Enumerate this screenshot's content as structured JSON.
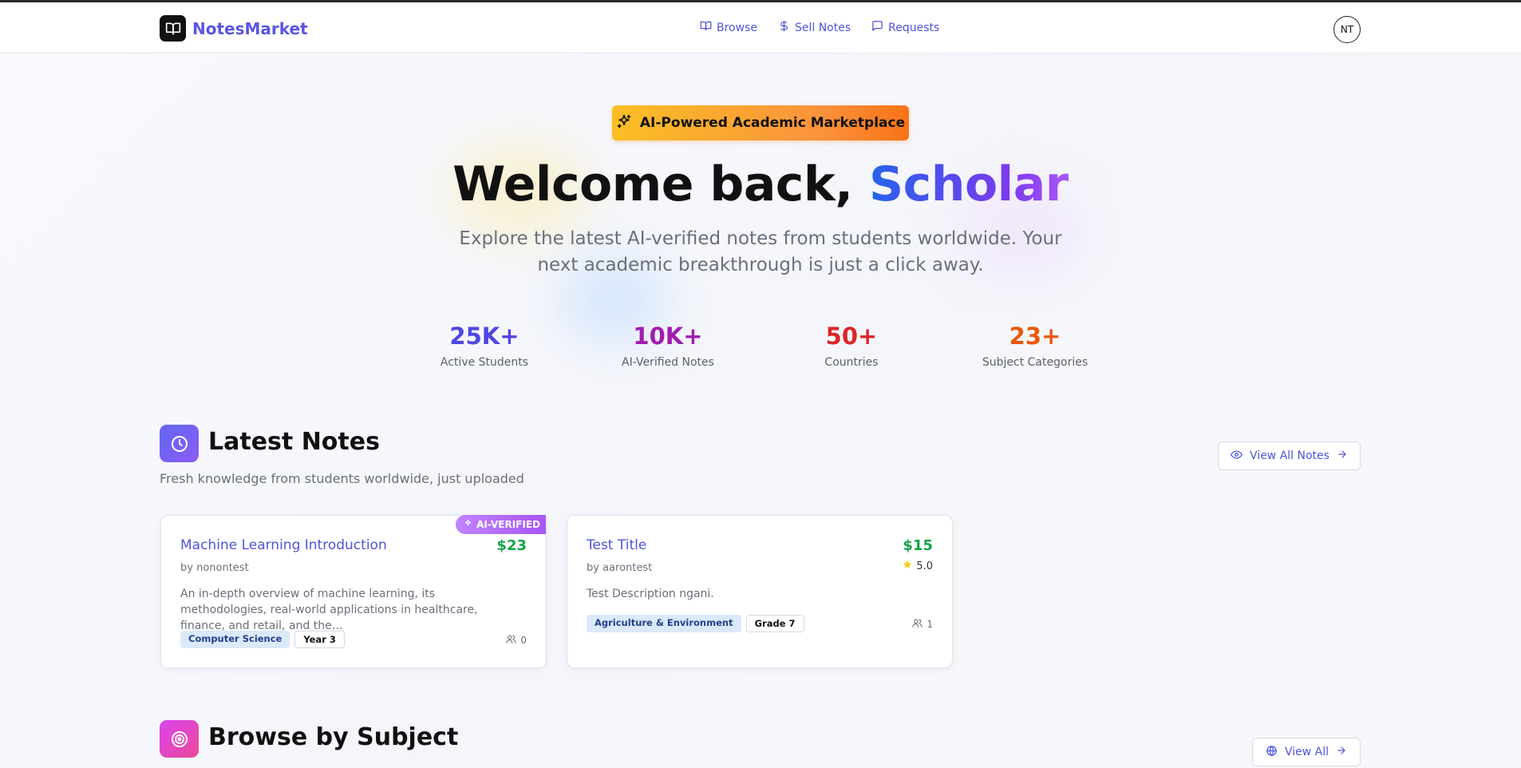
{
  "app": {
    "name": "NotesMarket"
  },
  "nav": {
    "items": [
      {
        "label": "Browse",
        "icon": "book-open-icon"
      },
      {
        "label": "Sell Notes",
        "icon": "dollar-icon"
      },
      {
        "label": "Requests",
        "icon": "message-icon"
      }
    ]
  },
  "user": {
    "initials": "NT"
  },
  "hero": {
    "badge": "AI-Powered Academic Marketplace",
    "title_prefix": "Welcome back, ",
    "title_highlight": "Scholar",
    "subtitle": "Explore the latest AI-verified notes from students worldwide. Your next academic breakthrough is just a click away."
  },
  "stats": [
    {
      "value": "25K+",
      "label": "Active Students",
      "color": "#4f46e5"
    },
    {
      "value": "10K+",
      "label": "AI-Verified Notes",
      "color": "#a21caf"
    },
    {
      "value": "50+",
      "label": "Countries",
      "color": "#dc2626"
    },
    {
      "value": "23+",
      "label": "Subject Categories",
      "color": "#ea580c"
    }
  ],
  "latest": {
    "title": "Latest Notes",
    "subtitle": "Fresh knowledge from students worldwide, just uploaded",
    "view_all": "View All Notes",
    "notes": [
      {
        "title": "Machine Learning Introduction",
        "author": "by nonontest",
        "price": "$23",
        "badge": "AI-VERIFIED",
        "description": "An in-depth overview of machine learning, its methodologies, real-world applications in healthcare, finance, and retail, and the…",
        "tags": [
          "Computer Science",
          "Year 3"
        ],
        "count": "0"
      },
      {
        "title": "Test Title",
        "author": "by aarontest",
        "price": "$15",
        "rating": "5.0",
        "description": "Test Description ngani.",
        "tags": [
          "Agriculture & Environment",
          "Grade 7"
        ],
        "count": "1"
      }
    ]
  },
  "subjects": {
    "title": "Browse by Subject",
    "view_all": "View All"
  },
  "colors": {
    "accent": "#4f54d8",
    "price": "#16a34a"
  }
}
